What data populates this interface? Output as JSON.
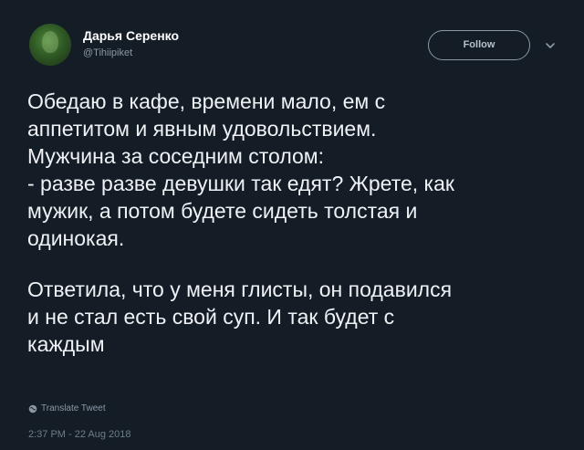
{
  "author": {
    "display_name": "Дарья Серенко",
    "handle": "@Tihiipiket",
    "avatar_icon": "user-avatar-icon"
  },
  "actions": {
    "follow_label": "Follow",
    "menu_icon": "chevron-down-icon"
  },
  "tweet": {
    "paragraph_1": "Обедаю в кафе, времени мало, ем с\nаппетитом и явным удовольствием.\nМужчина за соседним столом:\n- разве разве девушки так едят?  Жрете, как\nмужик, а потом будете сидеть толстая и\nодинокая.",
    "paragraph_2": "Ответила, что у меня глисты, он подавился\nи не стал есть свой суп. И так будет с\nкаждым"
  },
  "translate": {
    "icon": "globe-icon",
    "label": "Translate Tweet"
  },
  "timestamp": "2:37 PM - 22 Aug 2018",
  "colors": {
    "background": "#141d26",
    "text": "#eef2f5",
    "muted": "#8b98a5"
  }
}
